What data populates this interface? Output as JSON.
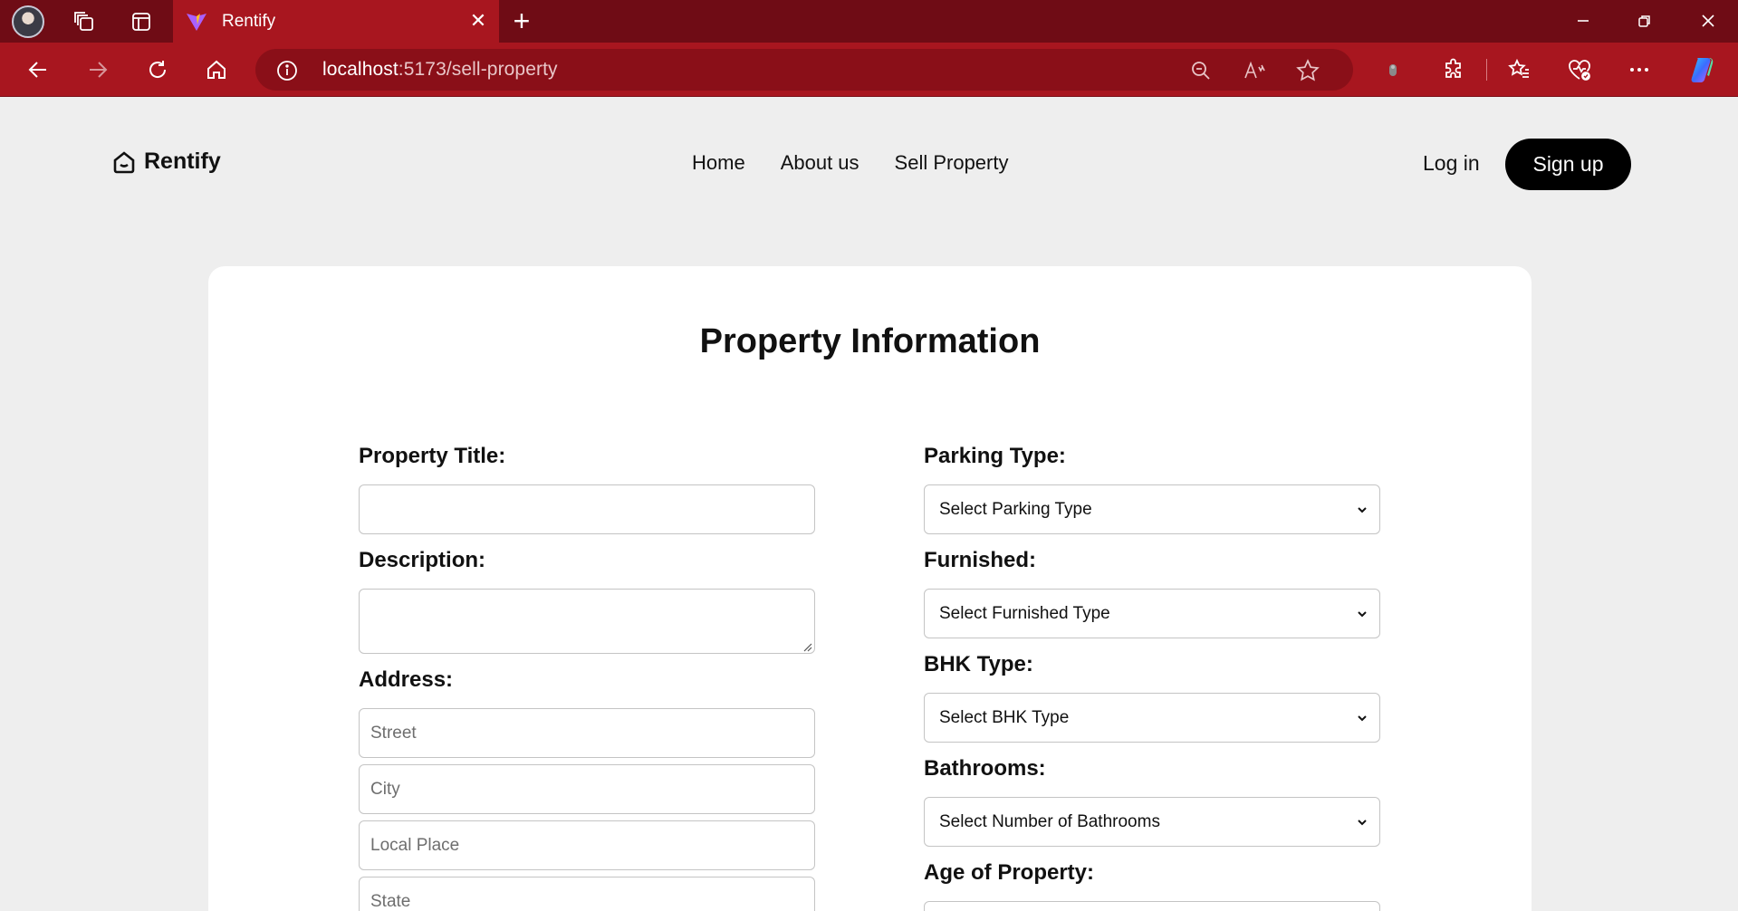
{
  "browser": {
    "tab_title": "Rentify",
    "url_host": "localhost",
    "url_path": ":5173/sell-property",
    "icons": [
      "avatar",
      "workspaces-icon",
      "tab-actions-icon",
      "vite-logo-icon",
      "close-icon",
      "plus-icon",
      "minimize-icon",
      "restore-icon",
      "window-close-icon",
      "back-icon",
      "forward-icon",
      "refresh-icon",
      "home-icon",
      "info-icon",
      "zoom-out-icon",
      "read-aloud-icon",
      "star-icon",
      "extension-dot-icon",
      "extensions-icon",
      "favorites-icon",
      "browser-essentials-icon",
      "more-icon",
      "copilot-icon"
    ]
  },
  "header": {
    "brand": "Rentify",
    "nav": [
      "Home",
      "About us",
      "Sell Property"
    ],
    "login": "Log in",
    "signup": "Sign up"
  },
  "form": {
    "title": "Property Information",
    "left": {
      "title_label": "Property Title:",
      "title_value": "",
      "description_label": "Description:",
      "description_value": "",
      "address_label": "Address:",
      "street_placeholder": "Street",
      "city_placeholder": "City",
      "local_place_placeholder": "Local Place",
      "state_placeholder": "State"
    },
    "right": {
      "parking_label": "Parking Type:",
      "parking_value": "Select Parking Type",
      "furnished_label": "Furnished:",
      "furnished_value": "Select Furnished Type",
      "bhk_label": "BHK Type:",
      "bhk_value": "Select BHK Type",
      "bathrooms_label": "Bathrooms:",
      "bathrooms_value": "Select Number of Bathrooms",
      "age_label": "Age of Property:"
    }
  },
  "colors": {
    "tabbar": "#6f0c15",
    "toolbar": "#a8161f",
    "page_bg": "#eeeeee",
    "button_bg": "#000000"
  }
}
